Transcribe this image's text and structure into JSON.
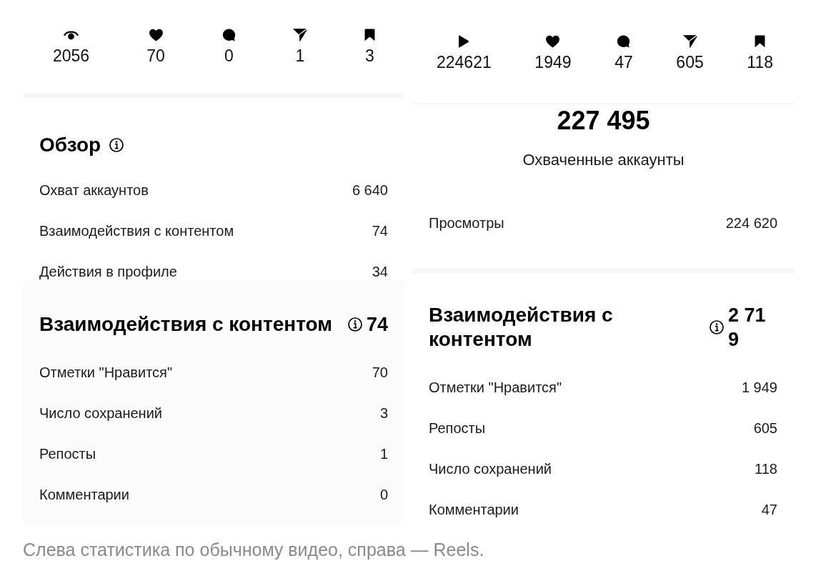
{
  "panels": [
    {
      "stats": [
        {
          "kind": "eye",
          "value": "2056"
        },
        {
          "kind": "heart",
          "value": "70"
        },
        {
          "kind": "comment",
          "value": "0"
        },
        {
          "kind": "send",
          "value": "1"
        },
        {
          "kind": "bookmark",
          "value": "3"
        }
      ],
      "sections": [
        {
          "kind": "overview",
          "title": "Обзор",
          "info": true,
          "rows": [
            {
              "label": "Охват аккаунтов",
              "value": "6 640"
            },
            {
              "label": "Взаимодействия с контентом",
              "value": "74"
            },
            {
              "label": "Действия в профиле",
              "value": "34"
            }
          ]
        },
        {
          "kind": "card",
          "title": "Взаимодействия с контентом",
          "info": true,
          "total": "74",
          "rows": [
            {
              "label": "Отметки \"Нравится\"",
              "value": "70"
            },
            {
              "label": "Число сохранений",
              "value": "3"
            },
            {
              "label": "Репосты",
              "value": "1"
            },
            {
              "label": "Комментарии",
              "value": "0"
            }
          ]
        }
      ]
    },
    {
      "stats": [
        {
          "kind": "play",
          "value": "224621"
        },
        {
          "kind": "heart",
          "value": "1949"
        },
        {
          "kind": "comment",
          "value": "47"
        },
        {
          "kind": "send",
          "value": "605"
        },
        {
          "kind": "bookmark",
          "value": "118"
        }
      ],
      "sections": [
        {
          "kind": "headline",
          "value": "227 495",
          "label": "Охваченные аккаунты",
          "rows": [
            {
              "label": "Просмотры",
              "value": "224 620"
            }
          ]
        },
        {
          "kind": "card",
          "title": "Взаимодействия с контентом",
          "info": true,
          "total": "2 719",
          "rows": [
            {
              "label": "Отметки \"Нравится\"",
              "value": "1 949"
            },
            {
              "label": "Репосты",
              "value": "605"
            },
            {
              "label": "Число сохранений",
              "value": "118"
            },
            {
              "label": "Комментарии",
              "value": "47"
            }
          ]
        }
      ]
    }
  ],
  "caption": "Слева статистика по обычному видео, справа — Reels."
}
